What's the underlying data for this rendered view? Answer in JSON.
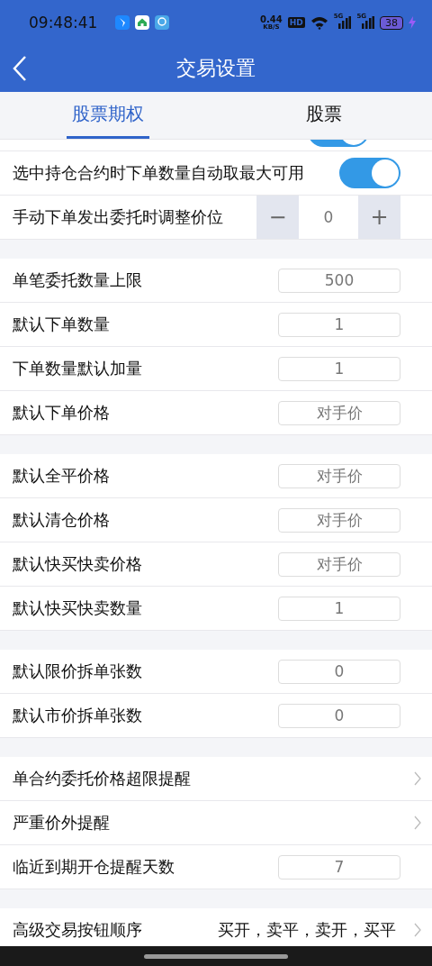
{
  "status_bar": {
    "time": "09:48:41",
    "speed": "0.44",
    "speed_unit": "KB/S",
    "hd": "HD",
    "signals": [
      "5G",
      "5G"
    ],
    "battery": "38",
    "charging": true
  },
  "header": {
    "title": "交易设置"
  },
  "tabs": [
    {
      "label": "股票期权",
      "selected": true
    },
    {
      "label": "股票",
      "selected": false
    }
  ],
  "sections": [
    {
      "rows": [
        {
          "kind": "toggle-cut",
          "on": true
        },
        {
          "kind": "toggle",
          "label": "选中持仓合约时下单数量自动取最大可用",
          "on": true
        },
        {
          "kind": "stepper",
          "label": "手动下单发出委托时调整价位",
          "minus": "−",
          "value": "0",
          "plus": "+"
        }
      ]
    },
    {
      "rows": [
        {
          "kind": "input",
          "label": "单笔委托数量上限",
          "value": "500"
        },
        {
          "kind": "input",
          "label": "默认下单数量",
          "value": "1"
        },
        {
          "kind": "input",
          "label": "下单数量默认加量",
          "value": "1"
        },
        {
          "kind": "input",
          "label": "默认下单价格",
          "value": "对手价"
        }
      ]
    },
    {
      "rows": [
        {
          "kind": "input",
          "label": "默认全平价格",
          "value": "对手价"
        },
        {
          "kind": "input",
          "label": "默认清仓价格",
          "value": "对手价"
        },
        {
          "kind": "input",
          "label": "默认快买快卖价格",
          "value": "对手价"
        },
        {
          "kind": "input",
          "label": "默认快买快卖数量",
          "value": "1"
        }
      ]
    },
    {
      "rows": [
        {
          "kind": "input",
          "label": "默认限价拆单张数",
          "value": "0"
        },
        {
          "kind": "input",
          "label": "默认市价拆单张数",
          "value": "0"
        }
      ]
    },
    {
      "rows": [
        {
          "kind": "link",
          "label": "单合约委托价格超限提醒"
        },
        {
          "kind": "link",
          "label": "严重价外提醒"
        },
        {
          "kind": "input",
          "label": "临近到期开仓提醒天数",
          "value": "7"
        }
      ]
    },
    {
      "rows": [
        {
          "kind": "link",
          "label": "高级交易按钮顺序",
          "value": "买开，卖平，卖开，买平"
        }
      ]
    }
  ]
}
